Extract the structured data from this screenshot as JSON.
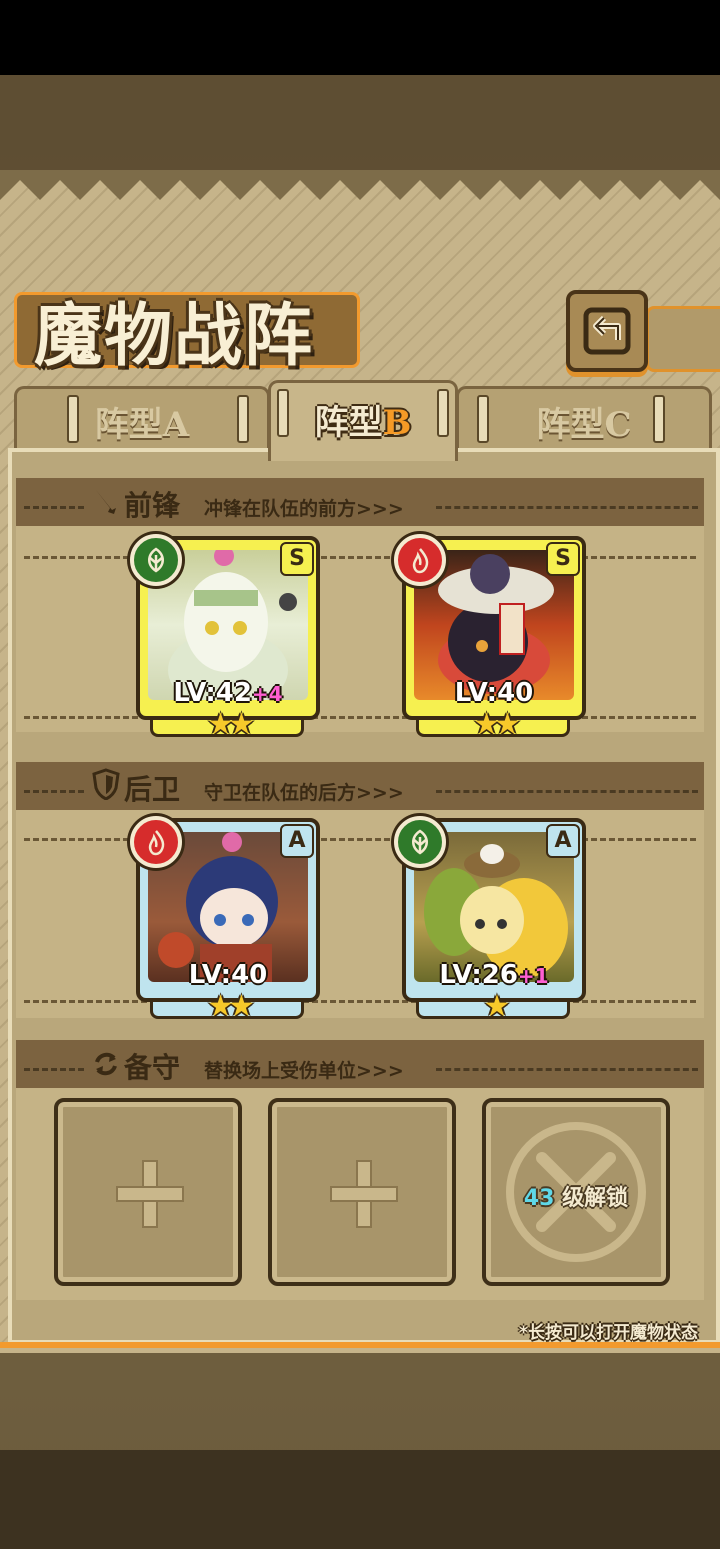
{
  "title": "魔物战阵",
  "tabs": [
    {
      "label": "阵型",
      "letter": "A",
      "active": false
    },
    {
      "label": "阵型",
      "letter": "B",
      "active": true
    },
    {
      "label": "阵型",
      "letter": "C",
      "active": false
    }
  ],
  "sections": {
    "front": {
      "title": "前锋",
      "subtitle": "冲锋在队伍的前方>>>"
    },
    "back": {
      "title": "后卫",
      "subtitle": "守卫在队伍的后方>>>"
    },
    "reserve": {
      "title": "备守",
      "subtitle": "替换场上受伤单位>>>"
    }
  },
  "front_units": [
    {
      "rank": "S",
      "element": "grass",
      "level": "LV:42",
      "bonus": "+4",
      "stars": "★★",
      "color": "#e8f0d8"
    },
    {
      "rank": "S",
      "element": "fire",
      "level": "LV:40",
      "bonus": "",
      "stars": "★★",
      "color": "#d8542a"
    }
  ],
  "back_units": [
    {
      "rank": "A",
      "element": "fire",
      "level": "LV:40",
      "bonus": "",
      "stars": "★★",
      "color": "#a05a3a"
    },
    {
      "rank": "A",
      "element": "grass",
      "level": "LV:26",
      "bonus": "+1",
      "stars": "★",
      "color": "#f2d45a"
    }
  ],
  "reserve": {
    "lock_level": "43",
    "lock_text": "级解锁"
  },
  "hint": "*长按可以打开魔物状态",
  "colors": {
    "accent": "#f29a2e",
    "panel": "#c6b48a",
    "rank_s": "#f6f050",
    "rank_a": "#bfe4ee"
  }
}
